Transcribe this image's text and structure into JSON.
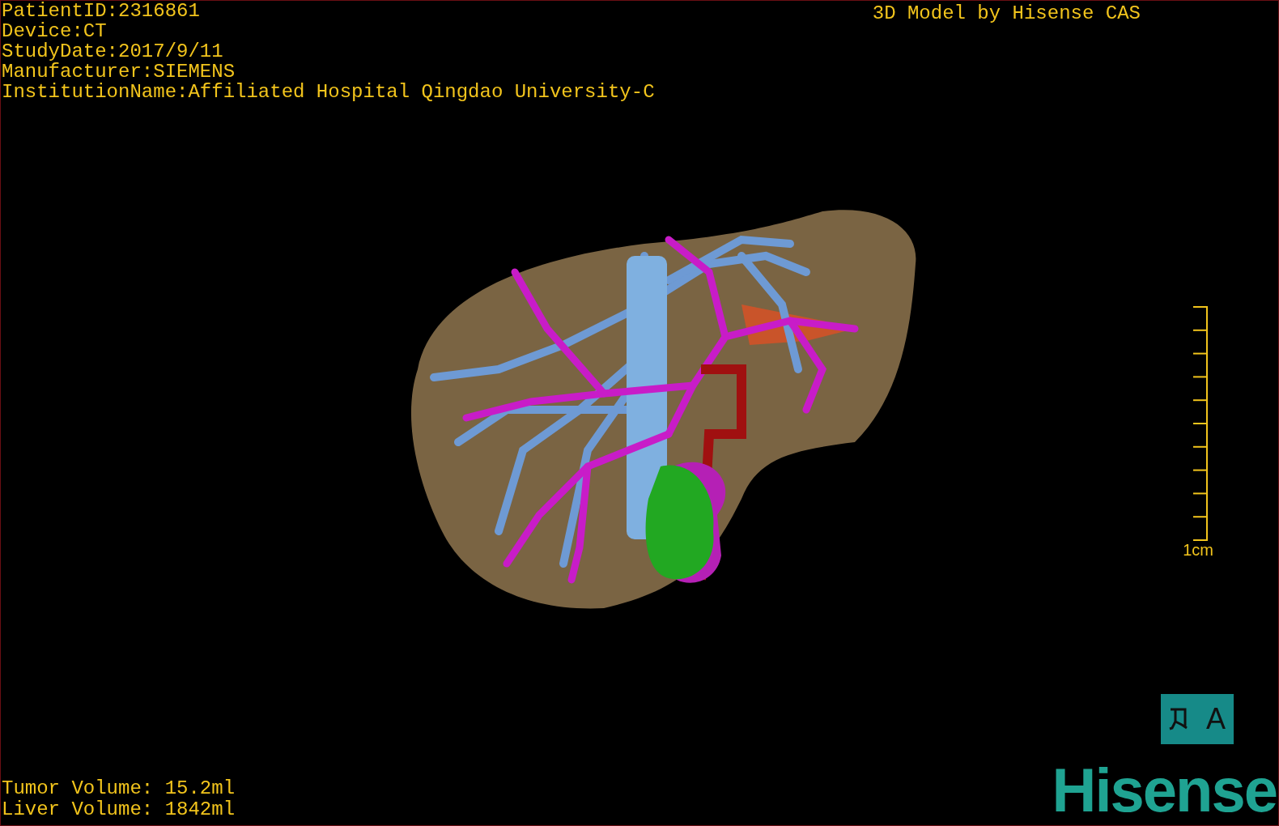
{
  "patient_info": [
    "PatientID:2316861",
    "Device:CT",
    "StudyDate:2017/9/11",
    "Manufacturer:SIEMENS",
    "InstitutionName:Affiliated Hospital Qingdao University-C"
  ],
  "title": "3D Model by Hisense CAS",
  "scale_bar": {
    "label": "1cm"
  },
  "volumes": [
    "Tumor Volume: 15.2ml",
    "Liver Volume: 1842ml"
  ],
  "orientation_marker": {
    "label": "A"
  },
  "logo": "Hisense"
}
